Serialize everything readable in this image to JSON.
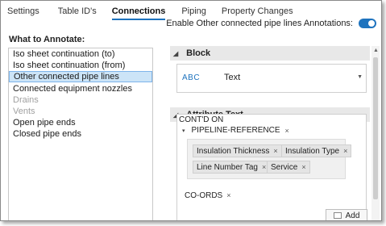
{
  "tabs": [
    "Settings",
    "Table ID's",
    "Connections",
    "Piping",
    "Property Changes"
  ],
  "enable_label": "Enable Other connected pipe lines Annotations:",
  "what_to_annotate": "What to Annotate:",
  "list_items": [
    "Iso sheet continuation (to)",
    "Iso sheet continuation (from)",
    "Other connected pipe lines",
    "Connected equipment nozzles",
    "Drains",
    "Vents",
    "Open pipe ends",
    "Closed pipe ends"
  ],
  "block": {
    "header": "Block",
    "abc": "ABC",
    "value": "Text"
  },
  "attribute": {
    "header": "Attribute Text",
    "contd": "CONT'D ON",
    "pipeline_ref": "PIPELINE-REFERENCE",
    "chips": [
      "Insulation Thickness",
      "Insulation Type",
      "Line Number Tag",
      "Service"
    ],
    "coords": "CO-ORDS"
  },
  "glyphs": {
    "tri_down": "▾",
    "tri_down_filled": "◢",
    "close": "×",
    "dropdown": "▼",
    "up": "▲"
  },
  "add_label": "Add",
  "accent_color": "#1e73be"
}
